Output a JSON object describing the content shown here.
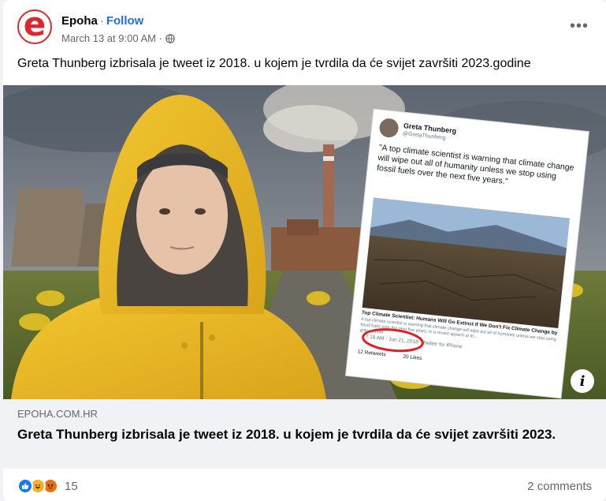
{
  "post": {
    "page_name": "Epoha",
    "separator": "·",
    "follow_label": "Follow",
    "timestamp": "March 13 at 9:00 AM ·",
    "avatar_letter": "e",
    "text": "Greta Thunberg izbrisala je tweet iz 2018. u kojem je tvrdila da će svijet završiti 2023.godine"
  },
  "image_overlay": {
    "tweet_author": "Greta Thunberg",
    "tweet_handle": "@GretaThunberg",
    "tweet_text": "\"A top climate scientist is warning that climate change will wipe out all of humanity unless we stop using fossil fuels over the next five years.\"",
    "article_title": "Top Climate Scientist: Humans Will Go Extinct If We Don't Fix Climate Change by ...",
    "article_desc": "A top climate scientist is warning that climate change will wipe out all of humanity unless we stop using fossil fuels over the next five years. In a recent speech at th...",
    "article_domain": "gritpost.com",
    "tweet_time": "7:18 AM · Jun 21, 2018 · Twitter for iPhone",
    "retweets": "12 Retweets",
    "likes": "20 Likes"
  },
  "link": {
    "domain": "EPOHA.COM.HR",
    "title": "Greta Thunberg izbrisala je tweet iz 2018. u kojem je tvrdila da će svijet završiti 2023."
  },
  "footer": {
    "reaction_count": "15",
    "comments_label": "2 comments"
  },
  "icons": {
    "more": "more-options-icon",
    "globe": "globe-icon",
    "info": "info-icon",
    "like": "like-reaction-icon",
    "haha": "haha-reaction-icon",
    "angry": "angry-reaction-icon"
  },
  "colors": {
    "brand_red": "#e0262d",
    "link_blue": "#216fdb",
    "like_blue": "#1877f2",
    "raincoat_yellow": "#e8b722"
  }
}
